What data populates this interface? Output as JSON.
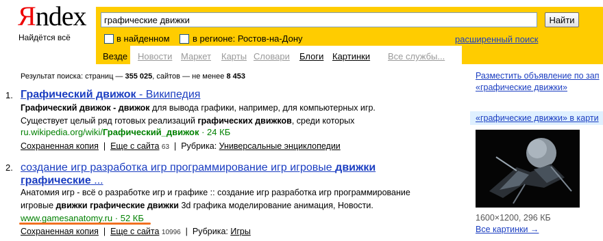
{
  "logo": {
    "first_letter": "Я",
    "rest": "ndex",
    "tagline": "Найдётся всё"
  },
  "search": {
    "query": "графические движки",
    "button_label": "Найти",
    "option_found": "в найденном",
    "option_region": "в регионе: Ростов-на-Дону",
    "advanced_link": "расширенный поиск"
  },
  "nav": {
    "active": "Везде",
    "tabs": [
      {
        "label": "Новости"
      },
      {
        "label": "Маркет"
      },
      {
        "label": "Карты"
      },
      {
        "label": "Словари"
      },
      {
        "label": "Блоги"
      },
      {
        "label": "Картинки"
      },
      {
        "label": "Все службы..."
      }
    ]
  },
  "stats": {
    "prefix": "Результат поиска: страниц — ",
    "pages": "355 025",
    "middle": ", сайтов — не менее ",
    "sites": "8 453"
  },
  "results": [
    {
      "num": "1.",
      "title_bold": "Графический движок",
      "title_rest": " - Википедия",
      "snippet_line1_html": [
        "Графический движок - движок",
        " для вывода графики, например, для компьютерных игр."
      ],
      "snippet_line2": [
        "Существует целый ряд готовых реализаций ",
        "графических движков",
        ", среди которых"
      ],
      "url_prefix": "ru.wikipedia.org/wiki/",
      "url_bold": "Графический_движок",
      "size": "24 КБ",
      "cached": "Сохраненная копия",
      "more": "Еще с сайта",
      "more_count": "63",
      "rubric_label": "Рубрика:",
      "rubric": "Универсальные энциклопедии"
    },
    {
      "num": "2.",
      "title_part1": "создание игр разработка игр программирование игр игровые ",
      "title_bold1": "движки",
      "title_bold2": "графические",
      "title_end": " ...",
      "snippet_line1": "Анатомия игр - всё о разработке игр и графике :: создание игр разработка игр программирование",
      "snippet_line2": [
        "игровые ",
        "движки графические движки",
        " 3d графика моделирование анимация, Новости."
      ],
      "url": "www.gamesanatomy.ru",
      "size": "52 КБ",
      "cached": "Сохраненная копия",
      "more": "Еще с сайта",
      "more_count": "10996",
      "rubric_label": "Рубрика:",
      "rubric": "Игры"
    }
  ],
  "right": {
    "ad_line1": "Разместить объявление по зап",
    "ad_line2": "«графические движки»",
    "pic_header": "«графические движки» в карти",
    "pic_dims": "1600×1200, 296 КБ",
    "more_pics": "Все картинки →"
  }
}
